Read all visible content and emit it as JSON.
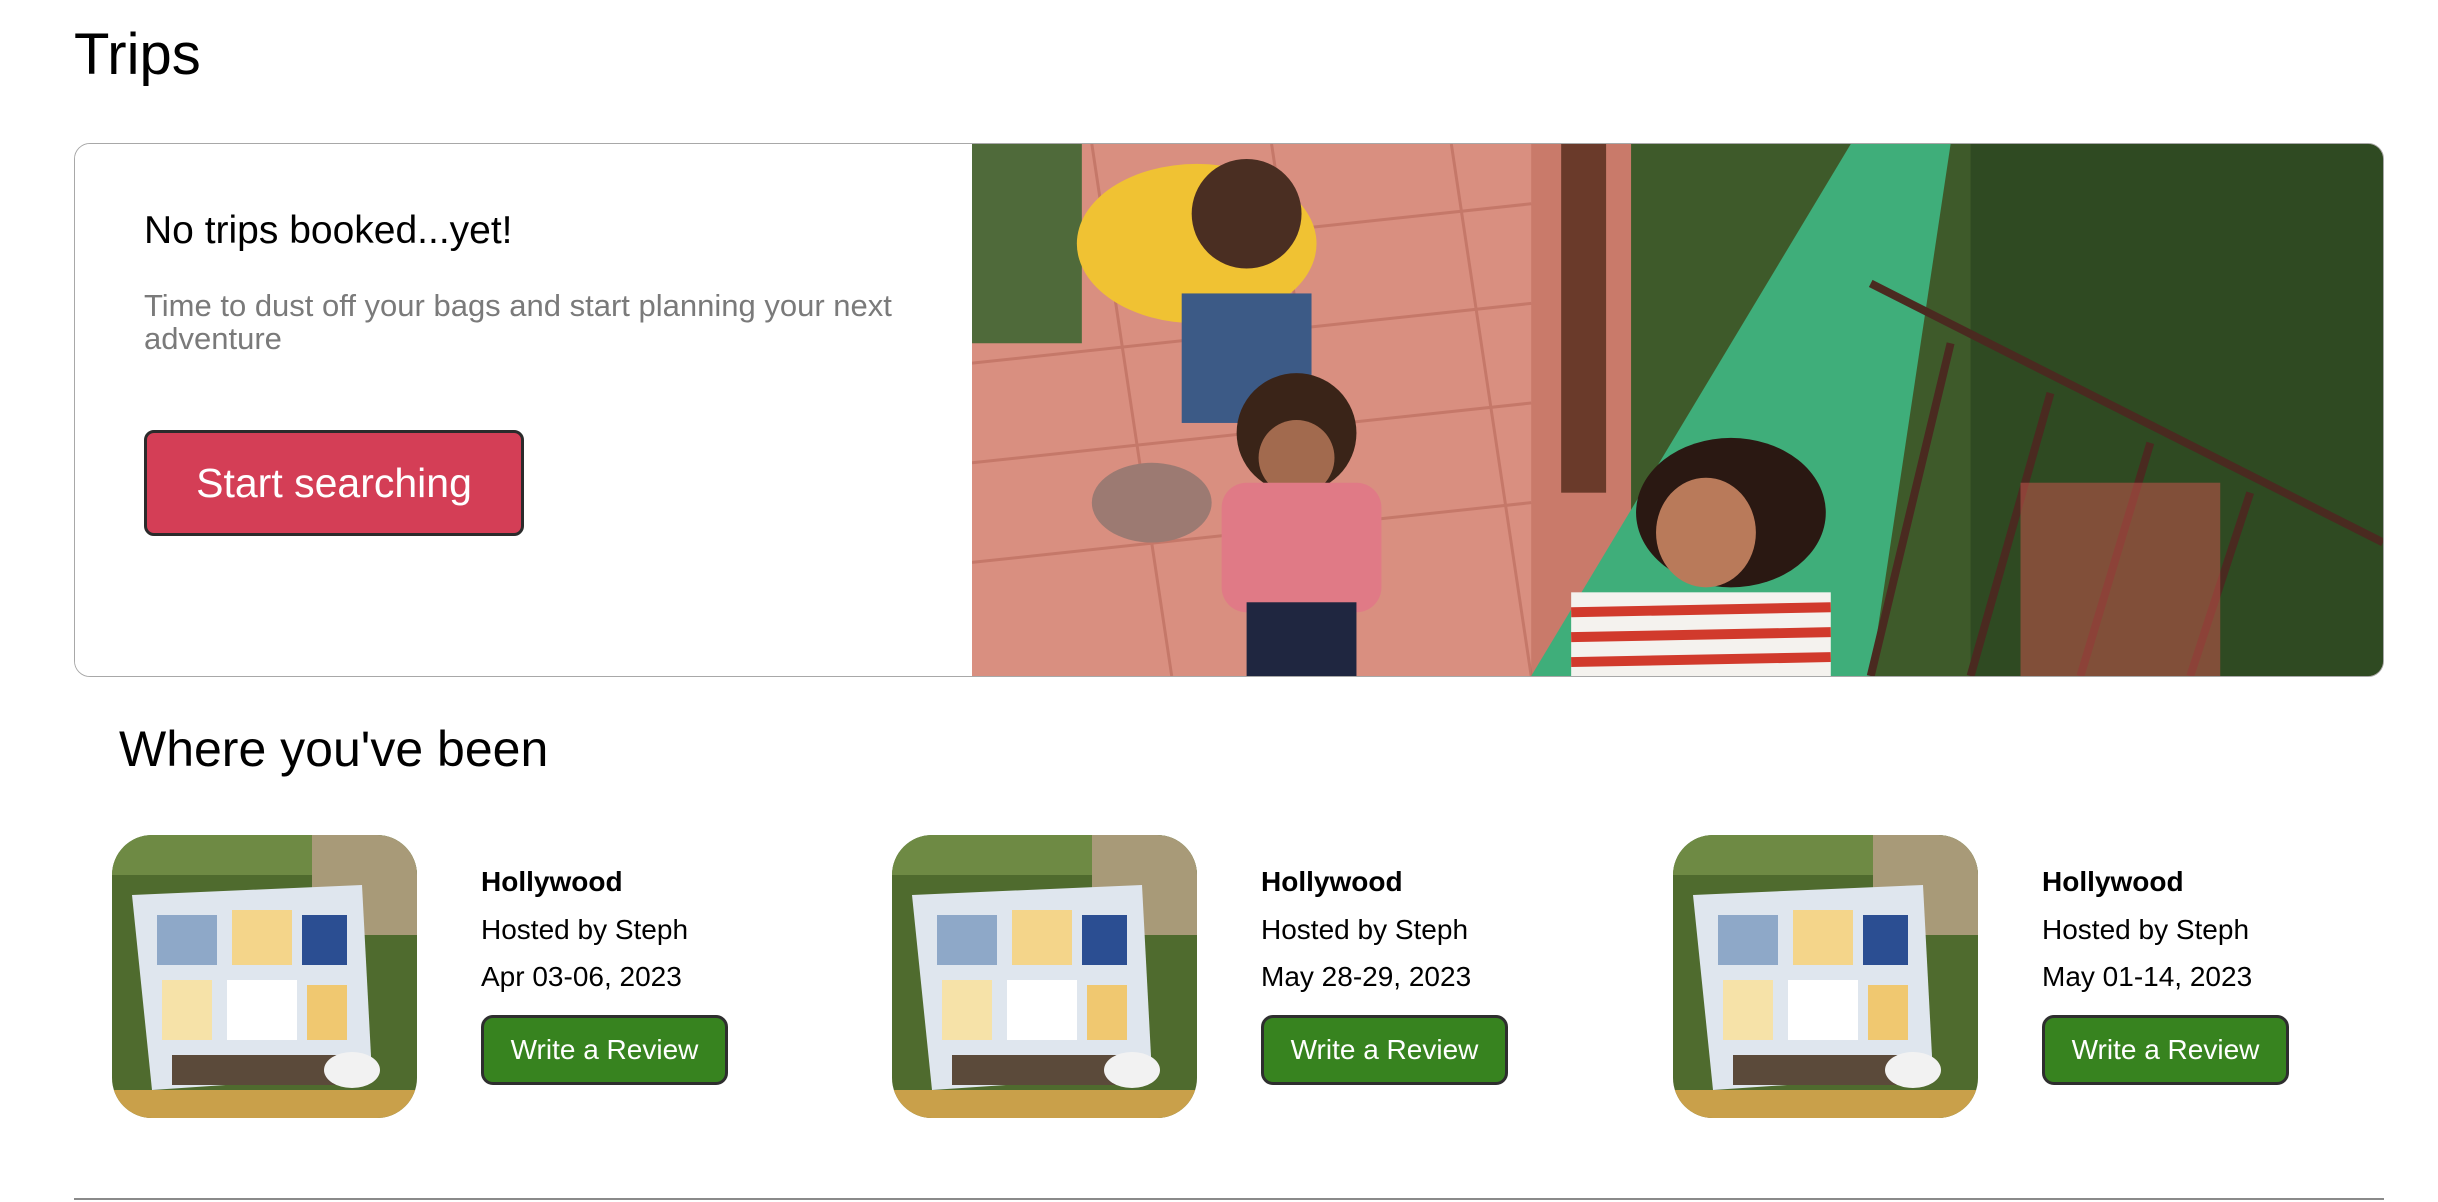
{
  "page": {
    "title": "Trips"
  },
  "hero": {
    "heading": "No trips booked...yet!",
    "subtext": "Time to dust off your bags and start planning your next adventure",
    "button_label": "Start searching"
  },
  "history": {
    "title": "Where you've been",
    "trips": [
      {
        "name": "Hollywood",
        "host": "Hosted by Steph",
        "dates": "Apr 03-06, 2023",
        "button_label": "Write a Review"
      },
      {
        "name": "Hollywood",
        "host": "Hosted by Steph",
        "dates": "May 28-29, 2023",
        "button_label": "Write a Review"
      },
      {
        "name": "Hollywood",
        "host": "Hosted by Steph",
        "dates": "May 01-14, 2023",
        "button_label": "Write a Review"
      }
    ]
  },
  "colors": {
    "primary_button": "#d43e56",
    "review_button": "#37831f",
    "subtext": "#7a7a7a"
  }
}
